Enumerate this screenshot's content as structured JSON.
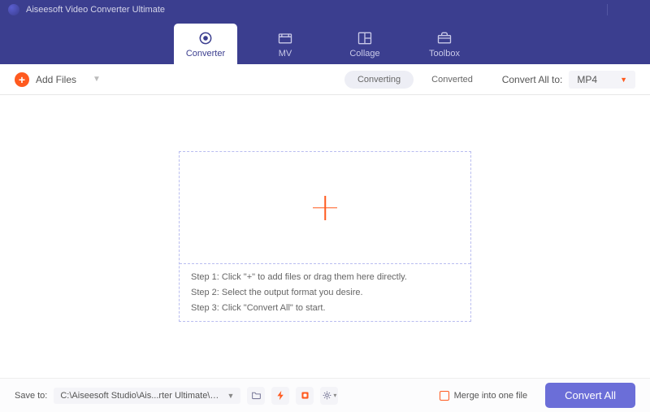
{
  "title": "Aiseesoft Video Converter Ultimate",
  "tabs": [
    {
      "label": "Converter"
    },
    {
      "label": "MV"
    },
    {
      "label": "Collage"
    },
    {
      "label": "Toolbox"
    }
  ],
  "toolbar": {
    "addFiles": "Add Files",
    "seg": {
      "converting": "Converting",
      "converted": "Converted"
    },
    "convertAllTo": "Convert All to:",
    "format": "MP4"
  },
  "dropzone": {
    "step1": "Step 1: Click \"+\" to add files or drag them here directly.",
    "step2": "Step 2: Select the output format you desire.",
    "step3": "Step 3: Click \"Convert All\" to start."
  },
  "footer": {
    "saveTo": "Save to:",
    "path": "C:\\Aiseesoft Studio\\Ais...rter Ultimate\\Converted",
    "merge": "Merge into one file",
    "convertAll": "Convert All"
  }
}
